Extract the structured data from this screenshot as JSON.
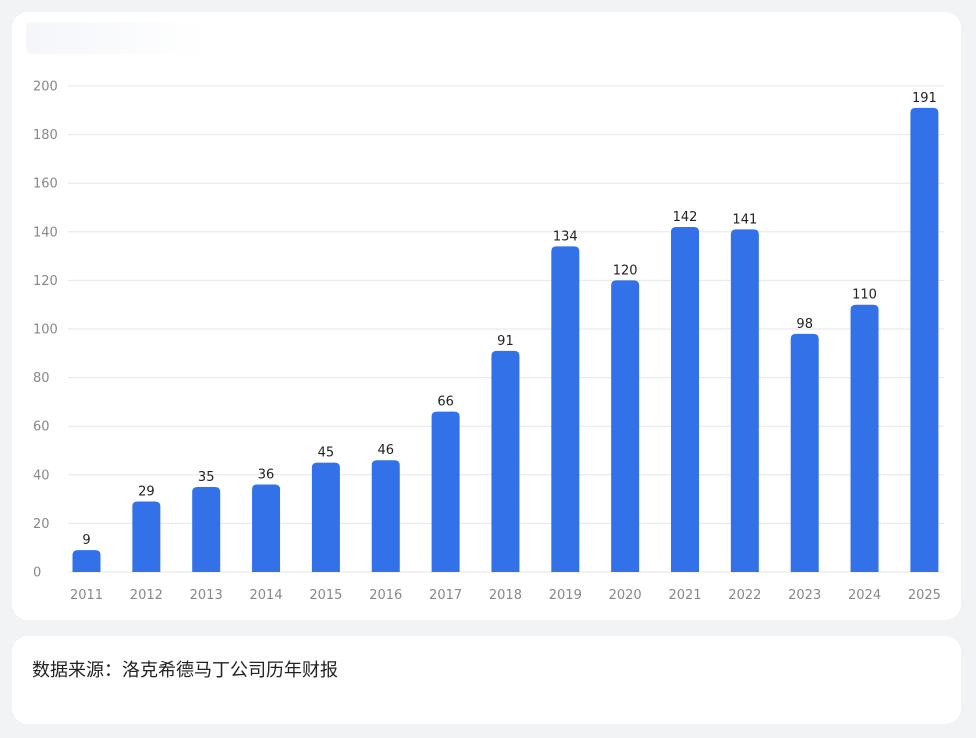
{
  "colors": {
    "bar": "#3271e8",
    "grid": "#e4e6ea",
    "axis_text": "#888888",
    "label_text": "#222222"
  },
  "chart_data": {
    "type": "bar",
    "categories": [
      "2011",
      "2012",
      "2013",
      "2014",
      "2015",
      "2016",
      "2017",
      "2018",
      "2019",
      "2020",
      "2021",
      "2022",
      "2023",
      "2024",
      "2025"
    ],
    "values": [
      9,
      29,
      35,
      36,
      45,
      46,
      66,
      91,
      134,
      120,
      142,
      141,
      98,
      110,
      191
    ],
    "title": "",
    "xlabel": "",
    "ylabel": "",
    "ylim": [
      0,
      200
    ],
    "yticks": [
      0,
      20,
      40,
      60,
      80,
      100,
      120,
      140,
      160,
      180,
      200
    ],
    "grid": true,
    "data_labels": true
  },
  "footer": {
    "source": "数据来源：洛克希德马丁公司历年财报"
  }
}
